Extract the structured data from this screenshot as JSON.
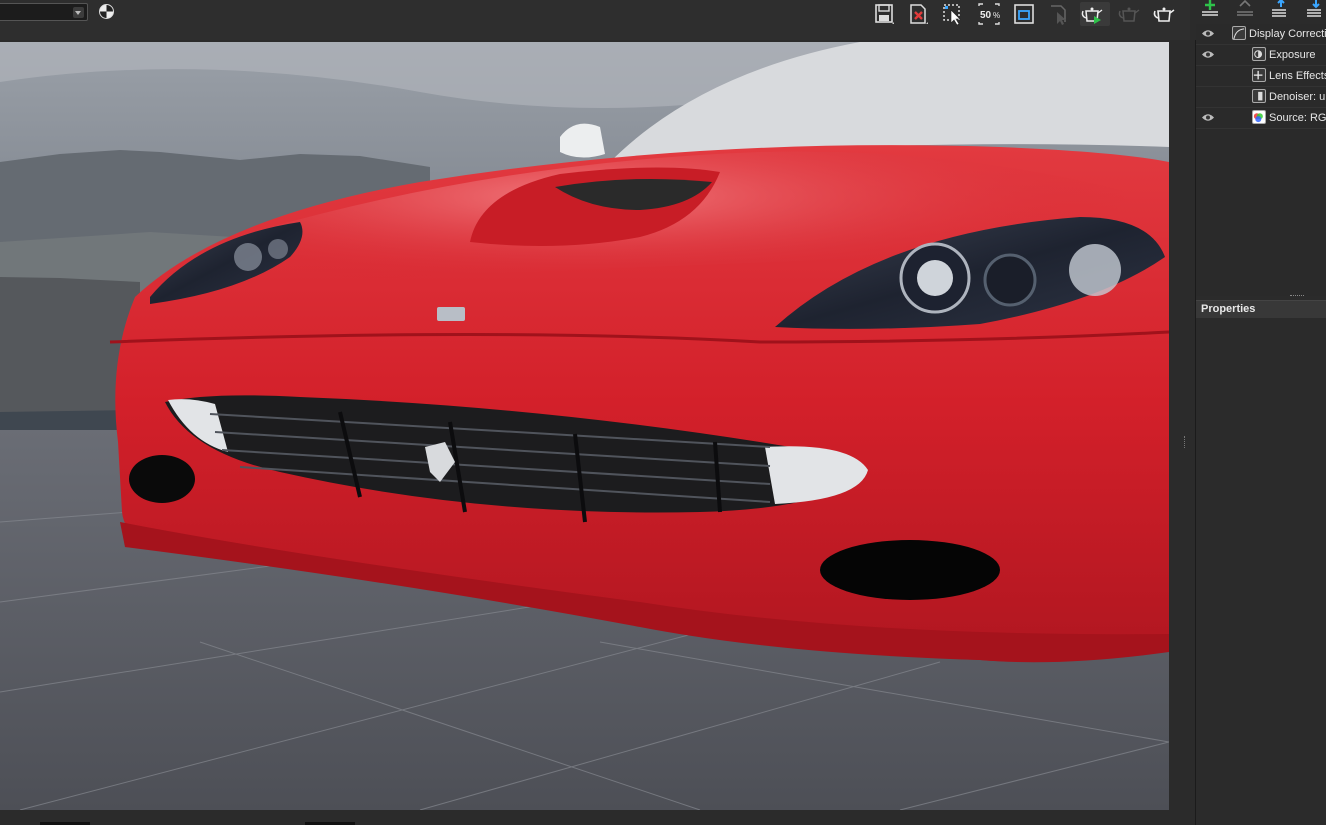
{
  "toolbar": {
    "dropdown_value": "",
    "buttons": [
      "save-icon",
      "close-image-icon",
      "region-select-icon",
      "zoom-50-icon",
      "fit-window-icon",
      "render-disabled-icon",
      "render-teapot-icon",
      "render-teapot-disabled-icon",
      "teapot-icon"
    ],
    "zoom_label": "50"
  },
  "layers_panel": {
    "toolbar_icons": [
      "add-layer-icon",
      "remove-layer-icon",
      "layer-up-icon",
      "layer-down-icon"
    ],
    "items": [
      {
        "label": "Display Correction",
        "icon": "curve-icon",
        "visible": true,
        "indent": 0
      },
      {
        "label": "Exposure",
        "icon": "exposure-icon",
        "visible": true,
        "indent": 1
      },
      {
        "label": "Lens Effects",
        "icon": "lens-effects-icon",
        "visible": false,
        "indent": 1
      },
      {
        "label": "Denoiser: un",
        "icon": "denoiser-icon",
        "visible": false,
        "indent": 1
      },
      {
        "label": "Source: RGB",
        "icon": "source-rgb-icon",
        "visible": true,
        "indent": 1
      }
    ]
  },
  "properties_panel": {
    "title": "Properties"
  },
  "viewport": {
    "subject": "render-image",
    "car_color": "#d9252c",
    "sky_color": "#8a9099",
    "ground_color": "#5d6069"
  }
}
